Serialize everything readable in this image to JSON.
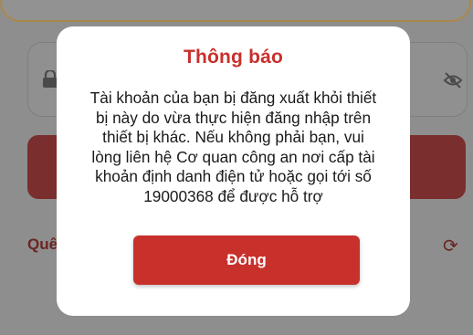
{
  "background": {
    "forgot_link_label": "Quê",
    "icons": [
      "lock-icon",
      "eye-slash-icon",
      "refresh-icon"
    ]
  },
  "dialog": {
    "title": "Thông báo",
    "message": "Tài khoản của bạn bị đăng xuất khỏi thiết\nbị này do vừa thực hiện đăng nhập trên\nthiết bị khác. Nếu không phải bạn, vui\nlòng liên hệ Cơ quan công an nơi cấp tài\nkhoản định danh điện tử hoặc gọi tới số\n19000368 để được hỗ trợ",
    "close_label": "Đóng"
  },
  "colors": {
    "accent": "#c8302b",
    "overlay": "#8e8e8e"
  }
}
